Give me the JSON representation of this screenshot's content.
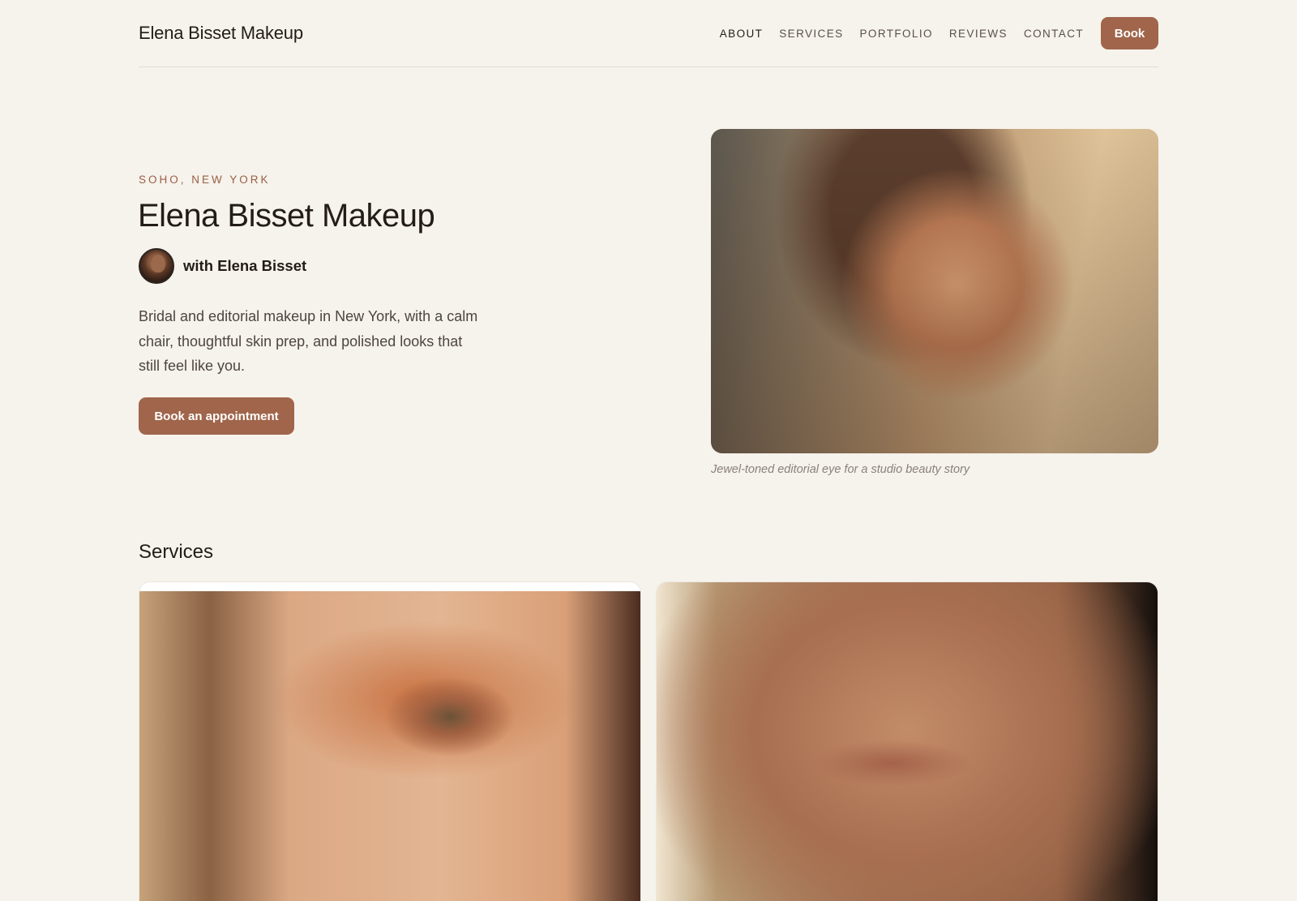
{
  "header": {
    "brand": "Elena Bisset Makeup",
    "nav": {
      "about": "ABOUT",
      "services": "SERVICES",
      "portfolio": "PORTFOLIO",
      "reviews": "REVIEWS",
      "contact": "CONTACT"
    },
    "book_label": "Book"
  },
  "hero": {
    "eyebrow": "SOHO, NEW YORK",
    "title": "Elena Bisset Makeup",
    "byline": "with Elena Bisset",
    "description": "Bridal and editorial makeup in New York, with a calm chair, thoughtful skin prep, and polished looks that still feel like you.",
    "cta_label": "Book an appointment",
    "image_caption": "Jewel-toned editorial eye for a studio beauty story"
  },
  "services": {
    "title": "Services"
  },
  "colors": {
    "accent": "#a0654b",
    "background": "#f6f2ec",
    "text": "#231c18"
  }
}
